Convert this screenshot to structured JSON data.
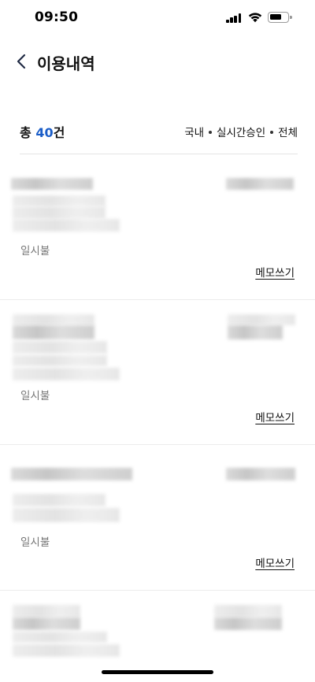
{
  "status_bar": {
    "time": "09:50"
  },
  "header": {
    "title": "이용내역"
  },
  "summary": {
    "total_prefix": "총",
    "total_count": "40",
    "total_suffix": "건",
    "filters": [
      "국내",
      "실시간승인",
      "전체"
    ]
  },
  "transactions": [
    {
      "payment_type": "일시불",
      "memo_label": "메모쓰기"
    },
    {
      "payment_type": "일시불",
      "memo_label": "메모쓰기"
    },
    {
      "payment_type": "일시불",
      "memo_label": "메모쓰기"
    }
  ]
}
